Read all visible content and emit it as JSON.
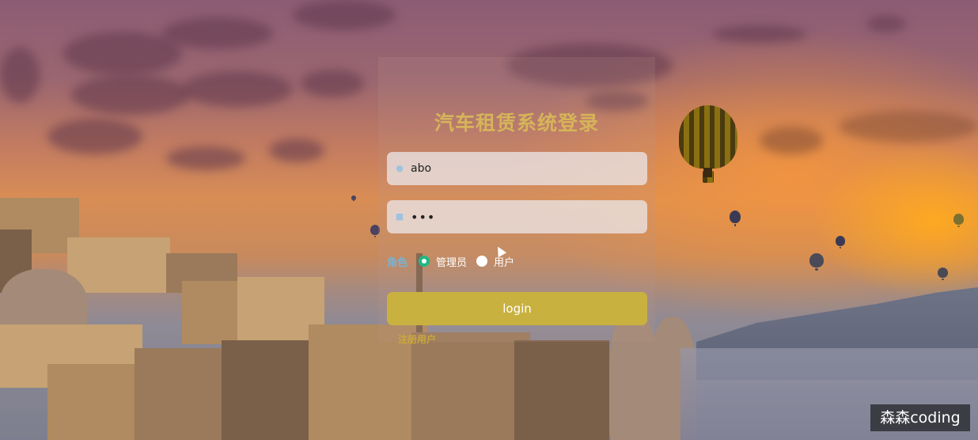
{
  "login": {
    "title": "汽车租赁系统登录",
    "username_value": "abo",
    "password_value": "•••",
    "role_label": "角色",
    "roles": [
      {
        "label": "管理员",
        "checked": true
      },
      {
        "label": "用户",
        "checked": false
      }
    ],
    "login_button": "login",
    "register_link": "注册用户"
  },
  "icons": {
    "username": "user-icon",
    "password": "lock-icon"
  },
  "colors": {
    "title": "#d6b45a",
    "login_button": "#c9b140",
    "role_label": "#74b4d8",
    "radio_checked": "#1fb982",
    "register_link": "#c9a83a"
  },
  "watermark": "森森coding"
}
